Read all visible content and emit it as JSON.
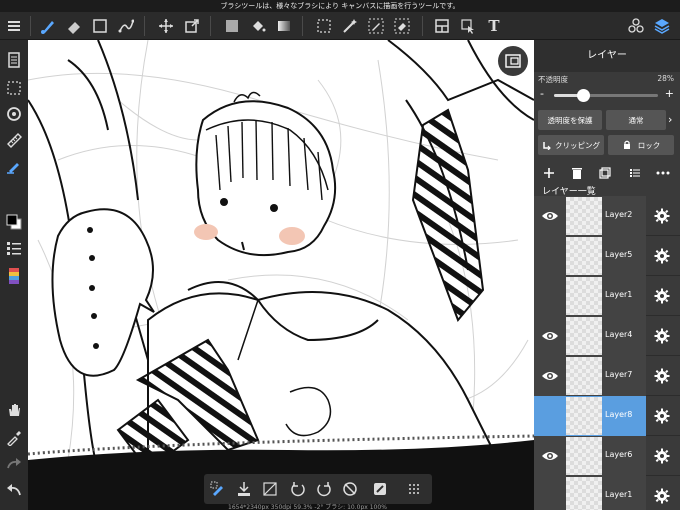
{
  "status_bar": {
    "text": "ブラシツールは、様々なブラシにより キャンバスに描画を行うツールです。"
  },
  "toolbar": {
    "text_tool_glyph": "T",
    "tools": [
      "menu-icon",
      "brush-icon",
      "eraser-icon",
      "rectangle-icon",
      "vector-pen-icon",
      "move-icon",
      "transform-icon",
      "fill-color-icon",
      "bucket-icon",
      "gradient-icon",
      "select-icon",
      "magic-wand-icon",
      "select-pen-icon",
      "select-eraser-icon",
      "frame-icon",
      "select-layer-icon",
      "text-icon",
      "material-icon",
      "layers-icon"
    ]
  },
  "left_bar": {
    "tools": [
      "page-icon",
      "selection-area-icon",
      "rotate-icon",
      "ruler-icon",
      "snap-pen-icon",
      "color-swatch-icon",
      "brush-list-icon",
      "palette-icon",
      "hand-icon",
      "eyedropper-icon",
      "redo-icon",
      "undo-icon"
    ]
  },
  "canvas": {
    "info": "1654*2340px 350dpi 59.3% -2° ブラシ: 10.0px 100%"
  },
  "bottom_toolbar": {
    "tools": [
      "selection-pen-icon",
      "selection-save-icon",
      "select-none-icon",
      "rotate-left-icon",
      "rotate-right-icon",
      "reset-icon",
      "snap-icon",
      "grid-icon"
    ]
  },
  "layer_panel": {
    "title": "レイヤー",
    "opacity_label": "不透明度",
    "opacity_value": "28%",
    "opacity_fraction": 0.28,
    "minus": "-",
    "plus": "+",
    "protect_alpha": "透明度を保護",
    "blend_mode": "通常",
    "clipping": "クリッピング",
    "lock": "ロック",
    "list_title": "レイヤー一覧",
    "accent_color": "#5a9ee0",
    "layers": [
      {
        "name": "Layer2",
        "visible": true,
        "selected": false
      },
      {
        "name": "Layer5",
        "visible": false,
        "selected": false
      },
      {
        "name": "Layer1",
        "visible": false,
        "selected": false
      },
      {
        "name": "Layer4",
        "visible": true,
        "selected": false
      },
      {
        "name": "Layer7",
        "visible": true,
        "selected": false
      },
      {
        "name": "Layer8",
        "visible": false,
        "selected": true
      },
      {
        "name": "Layer6",
        "visible": true,
        "selected": false
      },
      {
        "name": "Layer1",
        "visible": false,
        "selected": false
      }
    ]
  }
}
